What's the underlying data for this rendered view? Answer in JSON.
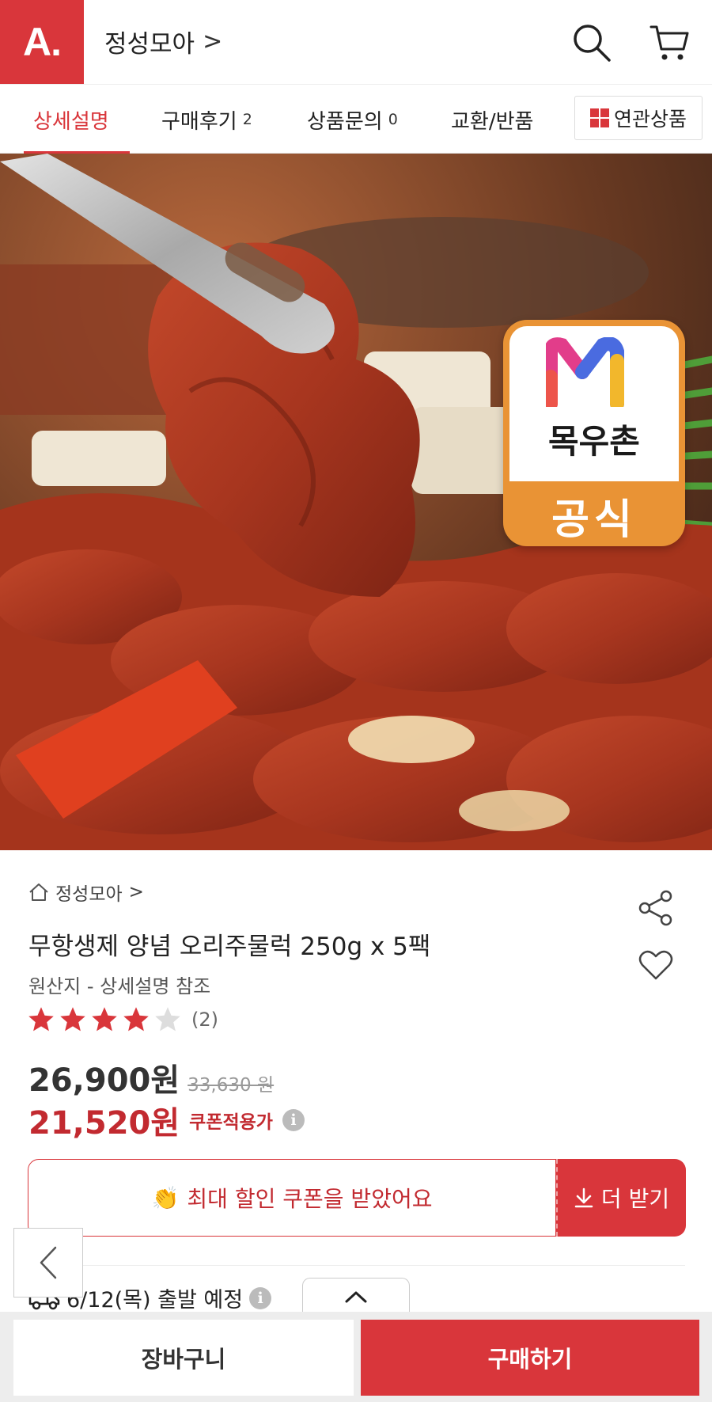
{
  "header": {
    "logo_text": "A.",
    "store_name": "정성모아",
    "store_chevron": ">"
  },
  "tabs": [
    {
      "label": "상세설명",
      "count": ""
    },
    {
      "label": "구매후기",
      "count": "2"
    },
    {
      "label": "상품문의",
      "count": "0"
    },
    {
      "label": "교환/반품",
      "count": ""
    }
  ],
  "related_label": "연관상품",
  "hero": {
    "badge_brand": "목우촌",
    "badge_official": "공식"
  },
  "product": {
    "breadcrumb": "정성모아",
    "breadcrumb_chevron": ">",
    "title": "무항생제 양념 오리주물럭 250g x 5팩",
    "origin": "원산지 - 상세설명 참조",
    "rating": 4,
    "rating_max": 5,
    "review_count": "(2)",
    "price": "26,900원",
    "original_price": "33,630 원",
    "coupon_price": "21,520원",
    "coupon_label": "쿠폰적용가",
    "info_symbol": "i"
  },
  "coupon": {
    "emoji": "👏",
    "message": "최대 할인 쿠폰을 받았어요",
    "more_label": "더 받기"
  },
  "shipping": {
    "text": "6/12(목) 출발 예정"
  },
  "bottom": {
    "cart_label": "장바구니",
    "buy_label": "구매하기"
  },
  "colors": {
    "accent": "#d9363b",
    "star_on": "#d9363b",
    "star_off": "#dddddd",
    "badge_orange": "#e99335"
  }
}
